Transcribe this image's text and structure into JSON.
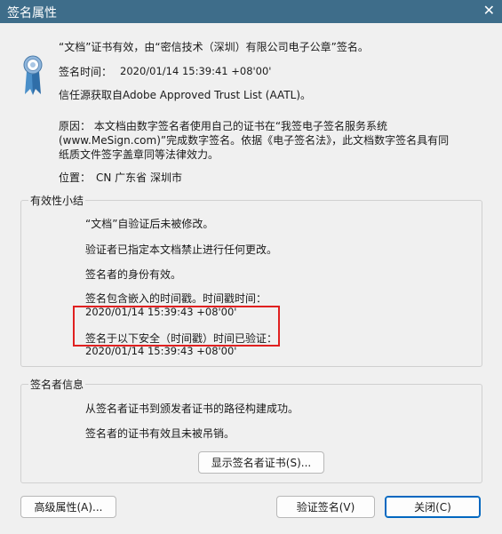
{
  "window": {
    "title": "签名属性",
    "close_glyph": "✕"
  },
  "header": {
    "status_line": "“文档”证书有效，由“密信技术（深圳）有限公司电子公章”签名。",
    "time_label": "签名时间：",
    "time_value": "2020/01/14 15:39:41 +08'00'",
    "trust_line": "信任源获取自Adobe Approved Trust List (AATL)。",
    "reason_text": "原因：  本文档由数字签名者使用自己的证书在“我签电子签名服务系统(www.MeSign.com)”完成数字签名。依据《电子签名法》，此文档数字签名具有同纸质文件签字盖章同等法律效力。",
    "location_label": "位置：",
    "location_value": "CN 广东省 深圳市"
  },
  "validity": {
    "legend": "有效性小结",
    "not_modified": "“文档”自验证后未被修改。",
    "no_changes_allowed": "验证者已指定本文档禁止进行任何更改。",
    "identity_valid": "签名者的身份有效。",
    "timestamp_embedded": "签名包含嵌入的时间戳。时间戳时间：",
    "timestamp_value": "2020/01/14 15:39:43 +08'00'",
    "verified_at_label": "签名于以下安全（时间戳）时间已验证：",
    "verified_at_value": "2020/01/14 15:39:43 +08'00'"
  },
  "signer": {
    "legend": "签名者信息",
    "path_built": "从签名者证书到颁发者证书的路径构建成功。",
    "not_revoked": "签名者的证书有效且未被吊销。",
    "show_cert_button": "显示签名者证书(S)..."
  },
  "footer": {
    "advanced_button": "高级属性(A)...",
    "validate_button": "验证签名(V)",
    "close_button": "关闭(C)"
  },
  "colors": {
    "titlebar": "#3e6d8a",
    "highlight_border": "#e02020",
    "primary_button_border": "#0067c0"
  },
  "icons": {
    "seal": "certificate-seal-icon",
    "close": "close-icon"
  }
}
